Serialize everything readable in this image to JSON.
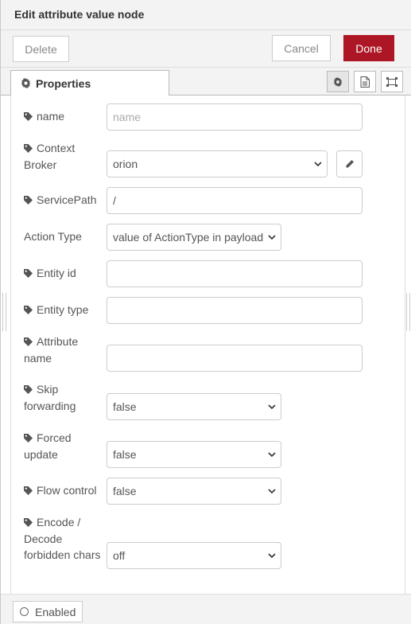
{
  "header": {
    "title": "Edit attribute value node"
  },
  "toolbar": {
    "delete_label": "Delete",
    "cancel_label": "Cancel",
    "done_label": "Done"
  },
  "tabs": {
    "properties_label": "Properties"
  },
  "form": {
    "name": {
      "label": "name",
      "placeholder": "name",
      "value": ""
    },
    "context_broker": {
      "label_line1": "Context",
      "label_line2": "Broker",
      "value": "orion"
    },
    "service_path": {
      "label": "ServicePath",
      "value": "/"
    },
    "action_type": {
      "label": "Action Type",
      "value": "value of ActionType in payload"
    },
    "entity_id": {
      "label": "Entity id",
      "value": ""
    },
    "entity_type": {
      "label": "Entity type",
      "value": ""
    },
    "attribute_name": {
      "label_line1": "Attribute",
      "label_line2": "name",
      "value": ""
    },
    "skip_forwarding": {
      "label_line1": "Skip",
      "label_line2": "forwarding",
      "value": "false"
    },
    "forced_update": {
      "label_line1": "Forced",
      "label_line2": "update",
      "value": "false"
    },
    "flow_control": {
      "label": "Flow control",
      "value": "false"
    },
    "encode_decode": {
      "label_line1": "Encode /",
      "label_line2": "Decode",
      "label_line3": "forbidden chars",
      "value": "off"
    }
  },
  "footer": {
    "enabled_label": "Enabled"
  },
  "colors": {
    "done_button": "#ad1625",
    "label_text": "#555555",
    "border": "#cccccc"
  }
}
